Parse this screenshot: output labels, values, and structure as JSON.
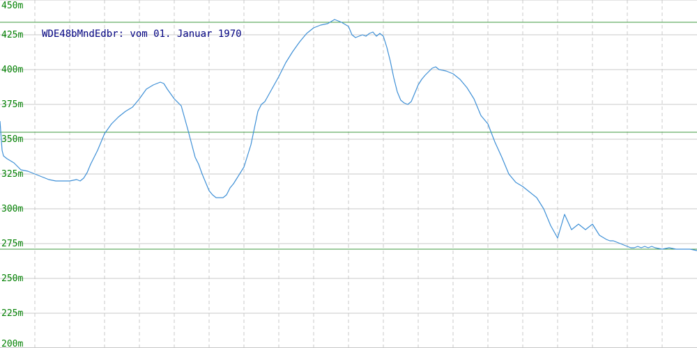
{
  "chart_data": {
    "type": "line",
    "title": "WDE48bMndEdbr: vom 01. Januar 1970",
    "xlabel": "",
    "ylabel": "",
    "ylim": [
      200,
      450
    ],
    "y_ticks": [
      {
        "value": 450,
        "label": "450m"
      },
      {
        "value": 425,
        "label": "425m"
      },
      {
        "value": 400,
        "label": "400m"
      },
      {
        "value": 375,
        "label": "375m"
      },
      {
        "value": 350,
        "label": "350m"
      },
      {
        "value": 325,
        "label": "325m"
      },
      {
        "value": 300,
        "label": "300m"
      },
      {
        "value": 275,
        "label": "275m"
      },
      {
        "value": 250,
        "label": "250m"
      },
      {
        "value": 225,
        "label": "225m"
      },
      {
        "value": 200,
        "label": "200m"
      }
    ],
    "grid": true,
    "reference_lines": [
      434,
      355,
      271
    ],
    "colors": {
      "line": "#3d8fd6",
      "reference": "#3c9a3c",
      "grid": "#c8c8c8",
      "tick_label": "#008000",
      "title": "#000080"
    },
    "series": [
      {
        "x": [
          0,
          3,
          5,
          10,
          20,
          30,
          40,
          50,
          60,
          70,
          80,
          90,
          100,
          110,
          115,
          120,
          125,
          130,
          140,
          150,
          160,
          170,
          180,
          190,
          200,
          210,
          220,
          230,
          235,
          240,
          250,
          260,
          270,
          280,
          285,
          290,
          300,
          305,
          310,
          315,
          320,
          325,
          330,
          335,
          340,
          350,
          360,
          370,
          375,
          380,
          390,
          400,
          410,
          420,
          430,
          440,
          450,
          460,
          470,
          480,
          490,
          500,
          505,
          510,
          515,
          520,
          525,
          530,
          535,
          540,
          545,
          550,
          555,
          560,
          565,
          570,
          575,
          580,
          585,
          590,
          595,
          600,
          605,
          610,
          620,
          625,
          630,
          640,
          650,
          660,
          670,
          680,
          690,
          700,
          710,
          720,
          730,
          740,
          750,
          760,
          770,
          780,
          790,
          800,
          810,
          820,
          830,
          840,
          850,
          860,
          870,
          875,
          880,
          885,
          890,
          895,
          900,
          905,
          910,
          915,
          920,
          925,
          930,
          935,
          940,
          950,
          960,
          970,
          980,
          990,
          1000
        ],
        "y": [
          363,
          342,
          338,
          336,
          333,
          328,
          327,
          325,
          323,
          321,
          320,
          320,
          320,
          321,
          320,
          322,
          326,
          332,
          342,
          354,
          361,
          366,
          370,
          373,
          379,
          386,
          389,
          391,
          390,
          386,
          379,
          374,
          356,
          337,
          332,
          325,
          313,
          310,
          308,
          308,
          308,
          310,
          315,
          318,
          322,
          330,
          346,
          370,
          375,
          377,
          386,
          395,
          405,
          413,
          420,
          426,
          430,
          432,
          433,
          436,
          434,
          431,
          425,
          423,
          424,
          425,
          424,
          426,
          427,
          424,
          426,
          424,
          416,
          406,
          394,
          384,
          378,
          376,
          375,
          377,
          383,
          389,
          393,
          396,
          401,
          402,
          400,
          399,
          397,
          393,
          387,
          379,
          367,
          361,
          348,
          337,
          325,
          319,
          316,
          312,
          308,
          300,
          288,
          279,
          296,
          285,
          289,
          285,
          289,
          281,
          278,
          277,
          277,
          276,
          275,
          274,
          273,
          272,
          272,
          273,
          272,
          273,
          272,
          273,
          272,
          271,
          272,
          271,
          271,
          271,
          270
        ]
      }
    ]
  }
}
